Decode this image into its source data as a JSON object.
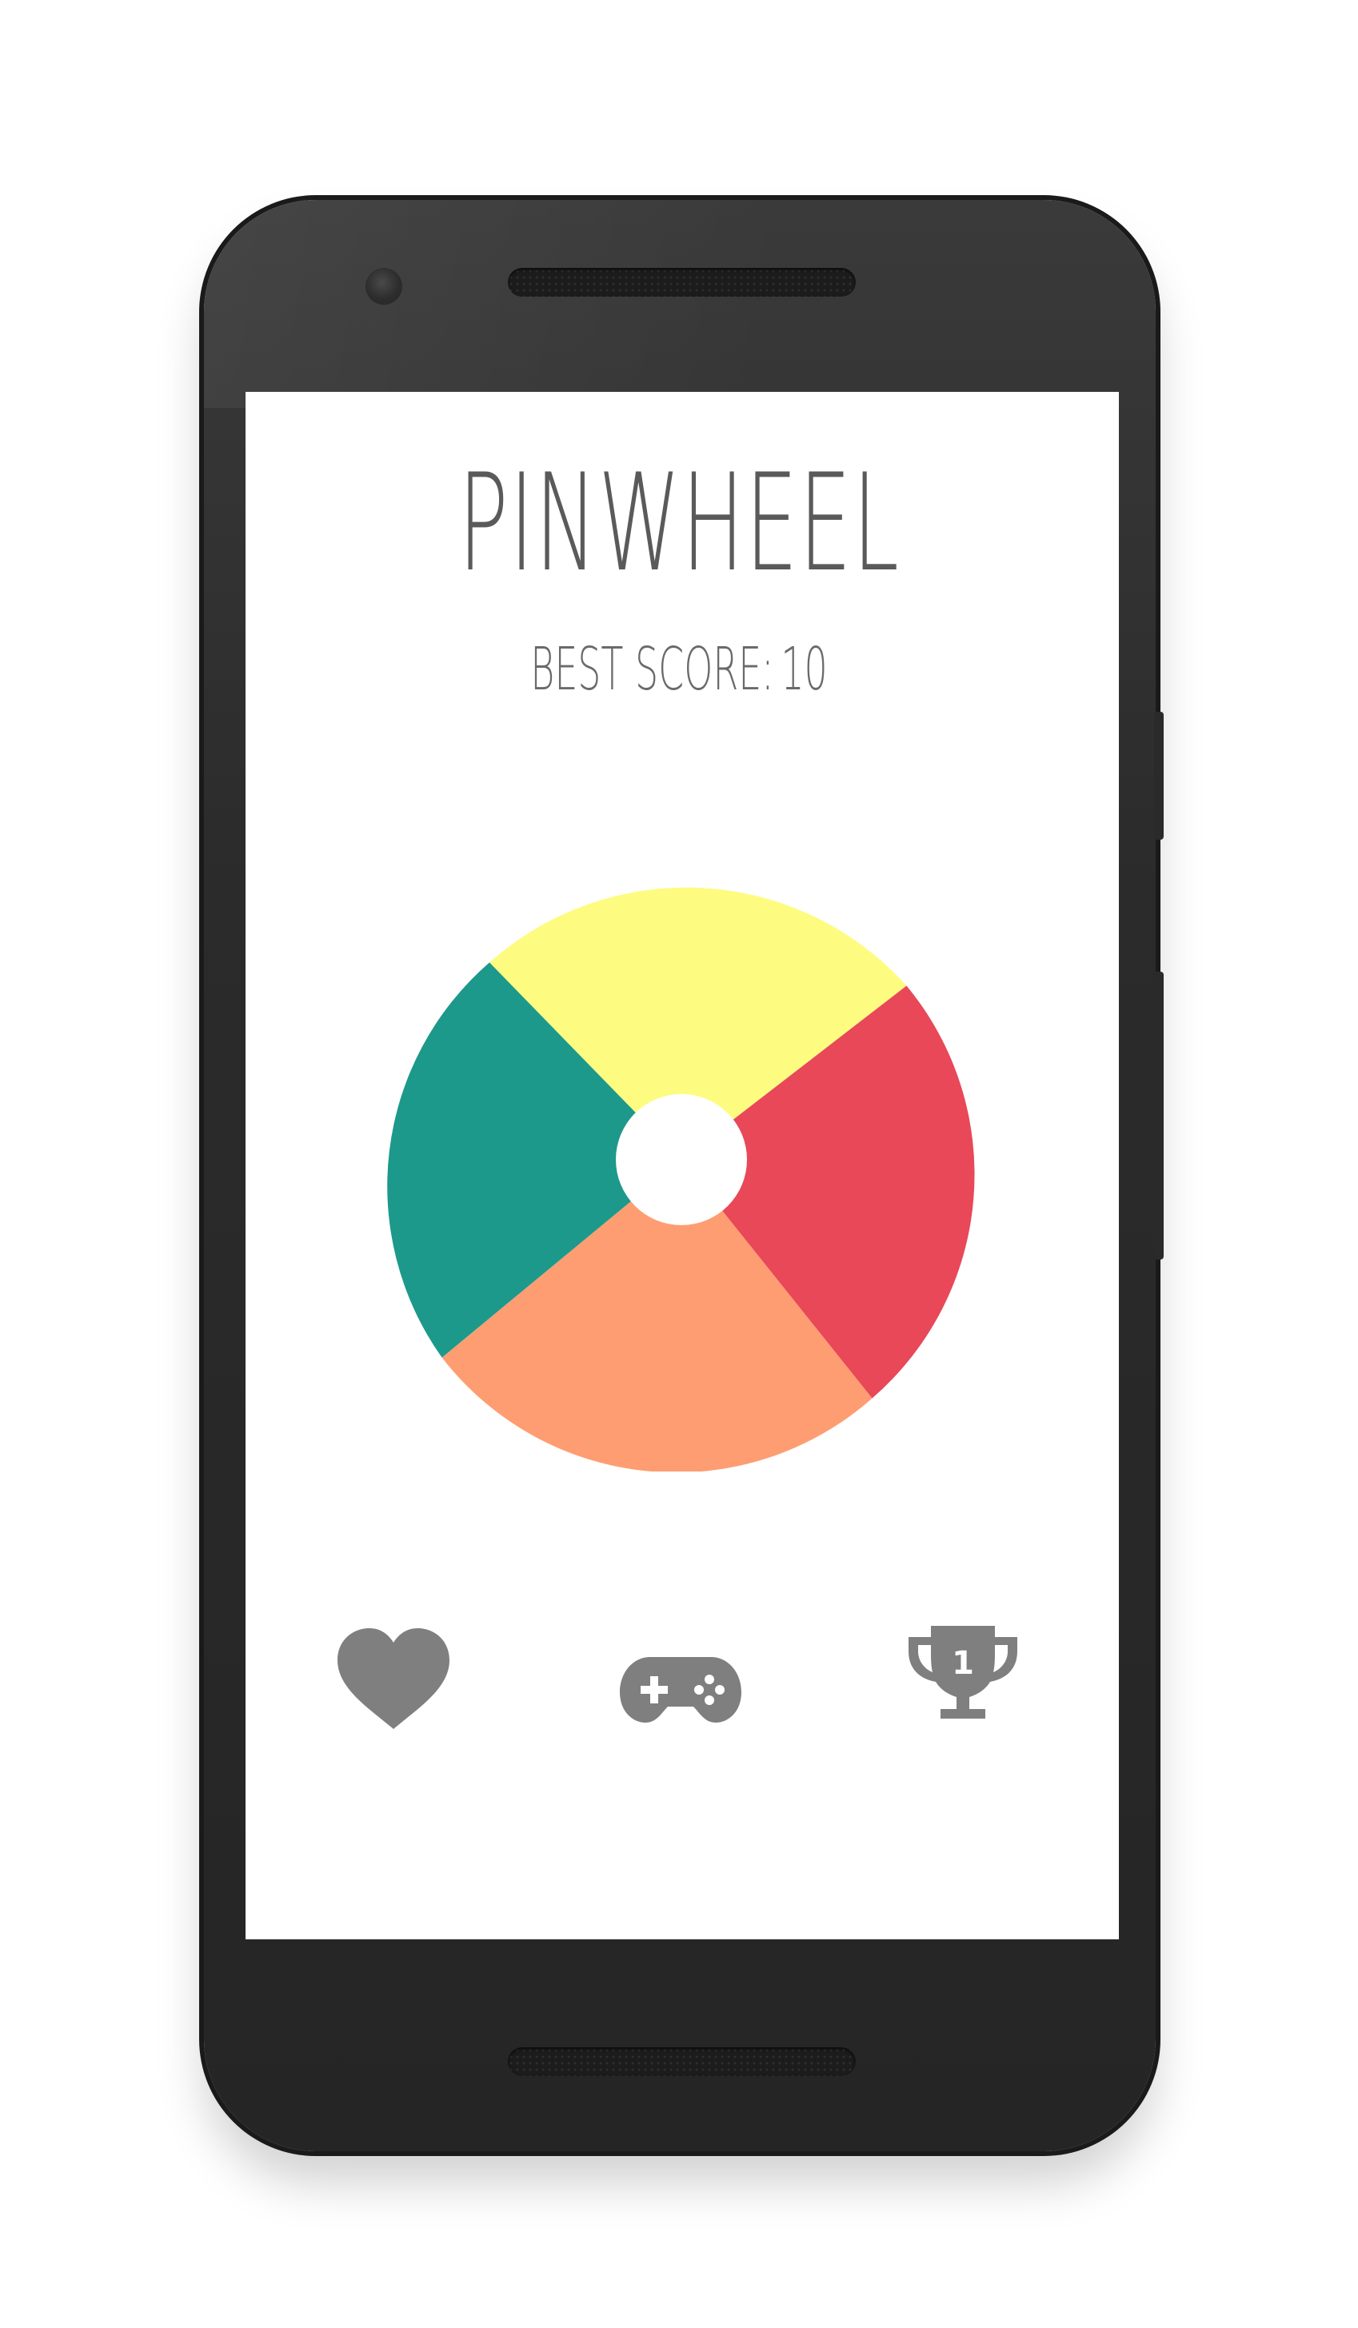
{
  "app": {
    "title": "PINWHEEL",
    "best_score_label": "BEST SCORE:",
    "best_score_value": "10"
  },
  "wheel": {
    "segments": [
      {
        "name": "yellow",
        "color": "#FDFC81"
      },
      {
        "name": "red",
        "color": "#E84857"
      },
      {
        "name": "orange",
        "color": "#FE9D72"
      },
      {
        "name": "teal",
        "color": "#1C998A"
      }
    ],
    "hub_color": "#FFFFFF"
  },
  "nav": {
    "items": [
      {
        "id": "favorite",
        "icon": "heart-icon"
      },
      {
        "id": "play",
        "icon": "gamepad-icon"
      },
      {
        "id": "leaderboard",
        "icon": "trophy-icon",
        "badge": "1"
      }
    ],
    "icon_color": "#7F7F7F"
  }
}
